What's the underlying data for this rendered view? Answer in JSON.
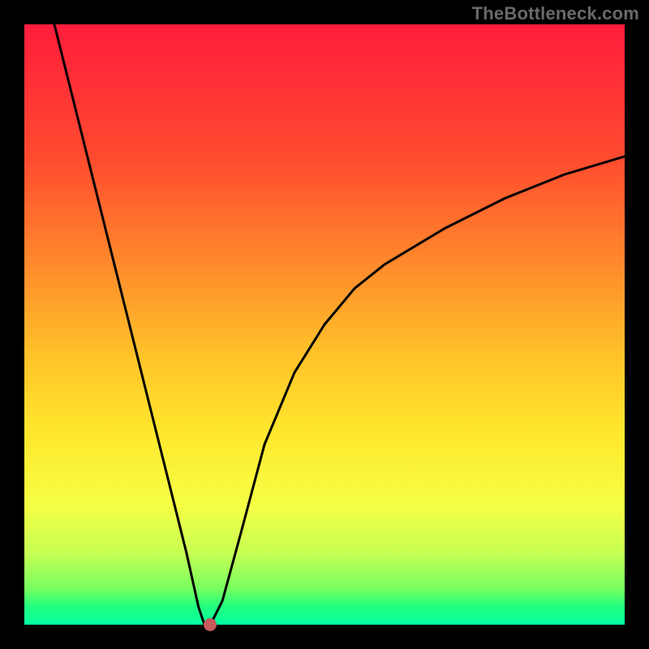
{
  "watermark": "TheBottleneck.com",
  "chart_data": {
    "type": "line",
    "title": "",
    "xlabel": "",
    "ylabel": "",
    "xlim": [
      0,
      100
    ],
    "ylim": [
      0,
      100
    ],
    "grid": false,
    "background_gradient": {
      "top": "#ff1d3c",
      "bottom": "#04ffa1",
      "description": "vertical rainbow heat gradient from red (high) through orange/yellow to green (low)"
    },
    "series": [
      {
        "name": "bottleneck-curve",
        "color": "#000000",
        "x": [
          5,
          10,
          15,
          20,
          24,
          27,
          29,
          30,
          31,
          33,
          36,
          40,
          45,
          50,
          55,
          60,
          70,
          80,
          90,
          100
        ],
        "y": [
          100,
          80,
          60,
          40,
          24,
          12,
          3,
          0,
          0,
          4,
          15,
          30,
          42,
          50,
          56,
          60,
          66,
          71,
          75,
          78
        ]
      }
    ],
    "marker": {
      "name": "optimal-point",
      "x": 31,
      "y": 0,
      "color": "#c65b5b"
    }
  }
}
